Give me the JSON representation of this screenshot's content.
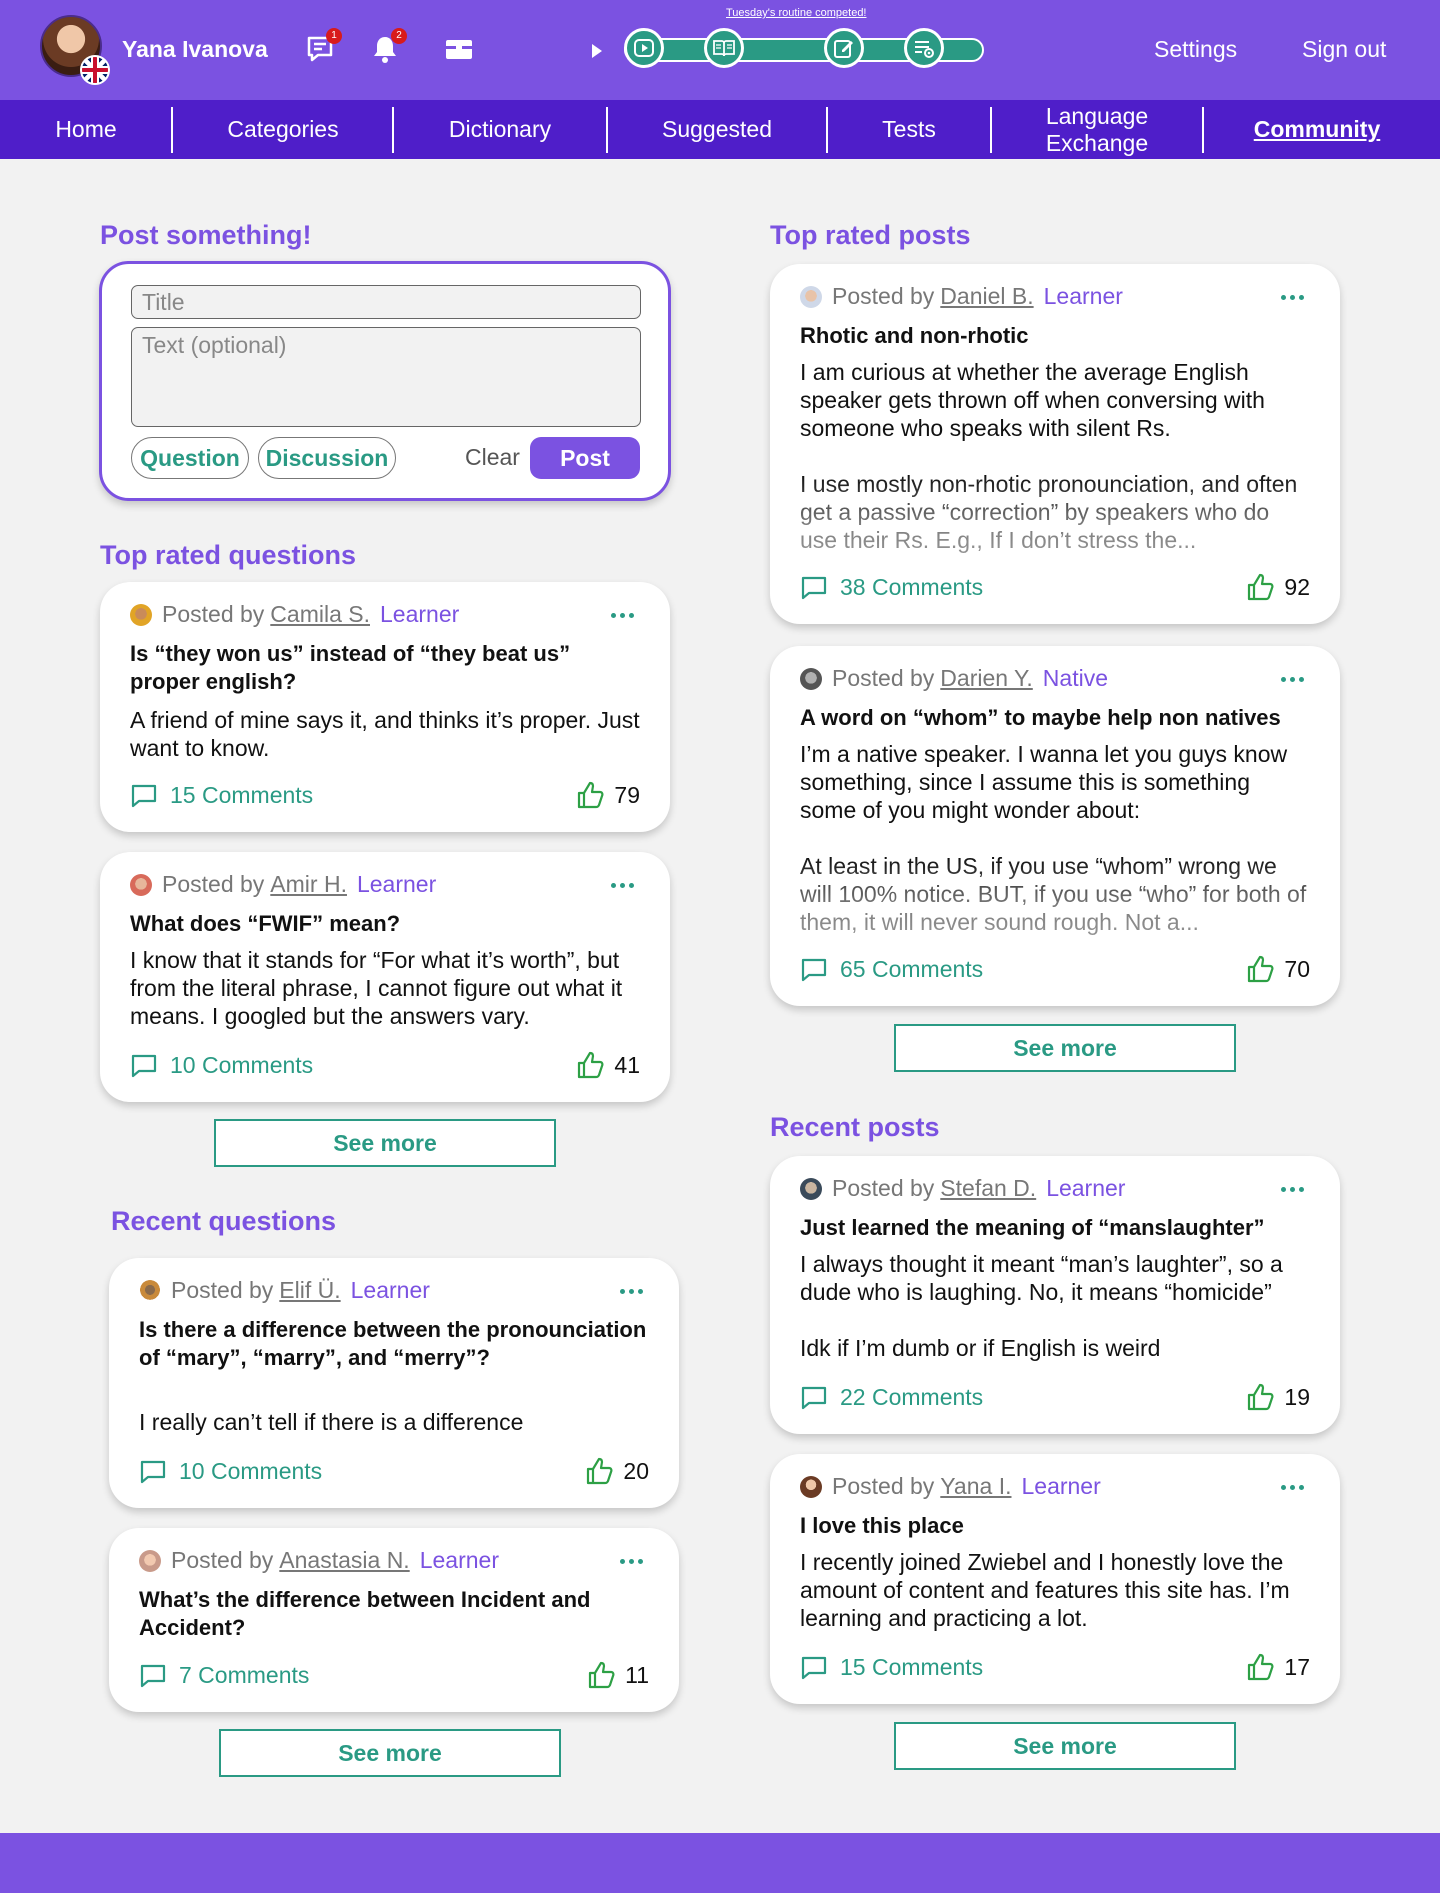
{
  "header": {
    "user_name": "Yana Ivanova",
    "messages_badge": "1",
    "notifications_badge": "2",
    "routine_note": "Tuesday's routine competed!",
    "settings_label": "Settings",
    "signout_label": "Sign out",
    "brand_color": "#7b52e1",
    "accent_color": "#2a9a84"
  },
  "nav": {
    "items": [
      {
        "label": "Home"
      },
      {
        "label": "Categories"
      },
      {
        "label": "Dictionary"
      },
      {
        "label": "Suggested"
      },
      {
        "label": "Tests"
      },
      {
        "label": "Language\nExchange"
      },
      {
        "label": "Community",
        "active": true
      }
    ]
  },
  "post_form": {
    "heading": "Post something!",
    "title_placeholder": "Title",
    "text_placeholder": "Text (optional)",
    "question_label": "Question",
    "discussion_label": "Discussion",
    "clear_label": "Clear",
    "post_label": "Post"
  },
  "top_questions": {
    "heading": "Top rated questions",
    "see_more": "See more",
    "posts": [
      {
        "posted_by": "Posted by",
        "author": "Camila S.",
        "role": "Learner",
        "title": "Is “they won us” instead of “they beat us” proper english?",
        "body": "A friend of mine says it, and thinks it’s proper. Just want to know.",
        "comments": "15 Comments",
        "likes": "79"
      },
      {
        "posted_by": "Posted by",
        "author": "Amir H.",
        "role": "Learner",
        "title": "What does “FWIF” mean?",
        "body": "I know that it stands for “For what it’s worth”, but from the literal phrase, I cannot figure out what it means. I googled but the answers vary.",
        "comments": "10 Comments",
        "likes": "41"
      }
    ]
  },
  "recent_questions": {
    "heading": "Recent questions",
    "see_more": "See more",
    "posts": [
      {
        "posted_by": "Posted by",
        "author": "Elif Ü.",
        "role": "Learner",
        "title": "Is there a difference between the pronounciation of “mary”, “marry”, and “merry”?",
        "body": "I really can’t tell if there is a difference",
        "comments": "10 Comments",
        "likes": "20"
      },
      {
        "posted_by": "Posted by",
        "author": "Anastasia N.",
        "role": "Learner",
        "title": "What’s the difference between Incident and Accident?",
        "comments": "7 Comments",
        "likes": "11"
      }
    ]
  },
  "top_posts": {
    "heading": "Top rated posts",
    "see_more": "See more",
    "posts": [
      {
        "posted_by": "Posted by",
        "author": "Daniel B.",
        "role": "Learner",
        "title": "Rhotic and non-rhotic",
        "body": "I am curious at whether the average English speaker gets thrown off when conversing with someone who speaks with silent Rs.\n\nI use mostly non-rhotic pronounciation, and often get a passive “correction” by speakers who do use their Rs. E.g., If I don’t stress the...",
        "comments": "38 Comments",
        "likes": "92"
      },
      {
        "posted_by": "Posted by",
        "author": "Darien Y.",
        "role": "Native",
        "title": "A word on “whom” to maybe help non natives",
        "body": "I’m a native speaker. I wanna let you guys know something, since I assume this is something some of you might wonder about:\n\nAt least in the US, if you use “whom” wrong we will 100% notice. BUT, if you use “who” for both of them, it will never sound rough. Not a...",
        "comments": "65 Comments",
        "likes": "70"
      }
    ]
  },
  "recent_posts": {
    "heading": "Recent posts",
    "see_more": "See more",
    "posts": [
      {
        "posted_by": "Posted by",
        "author": "Stefan D.",
        "role": "Learner",
        "title": "Just learned the meaning of “manslaughter”",
        "body": "I always thought it meant “man’s laughter”, so a dude who is laughing. No, it means “homicide”\n\nIdk if I’m dumb or if English is weird",
        "comments": "22 Comments",
        "likes": "19"
      },
      {
        "posted_by": "Posted by",
        "author": "Yana I.",
        "role": "Learner",
        "title": "I love this place",
        "body": "I recently joined Zwiebel and I honestly love the amount of content and features this site has. I’m learning and practicing a lot.",
        "comments": "15 Comments",
        "likes": "17"
      }
    ]
  }
}
